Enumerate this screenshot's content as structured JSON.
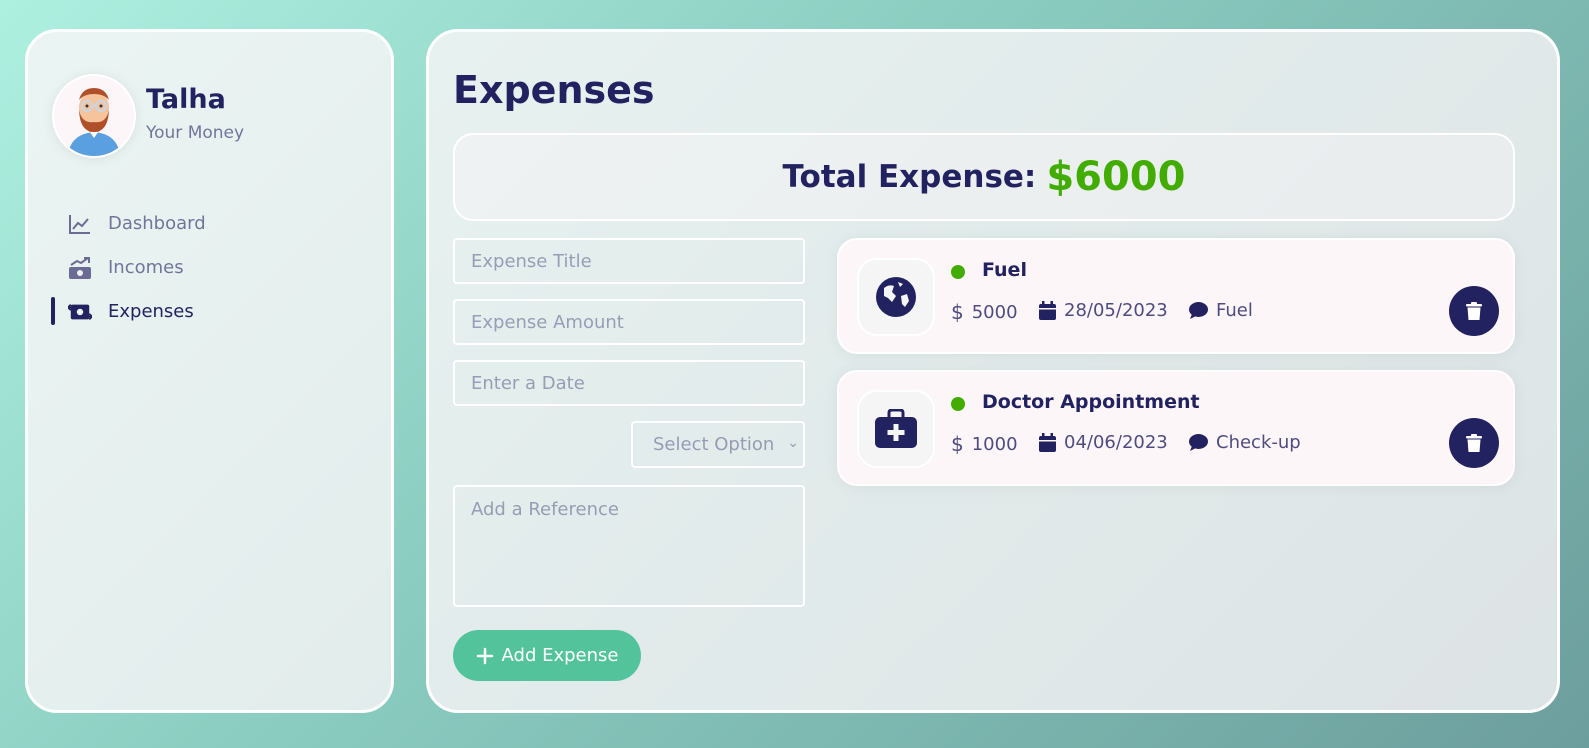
{
  "user": {
    "name": "Talha",
    "subtitle": "Your Money"
  },
  "nav": [
    {
      "label": "Dashboard",
      "icon": "chart-line-icon",
      "active": false
    },
    {
      "label": "Incomes",
      "icon": "money-bill-trend-icon",
      "active": false
    },
    {
      "label": "Expenses",
      "icon": "money-bill-transfer-icon",
      "active": true
    }
  ],
  "main": {
    "title": "Expenses",
    "total_label": "Total Expense:",
    "total_value": "$6000"
  },
  "form": {
    "title_placeholder": "Expense Title",
    "amount_placeholder": "Expense Amount",
    "date_placeholder": "Enter a Date",
    "category_selected": "Select Option",
    "reference_placeholder": "Add a Reference",
    "add_button": "Add Expense"
  },
  "expenses": [
    {
      "title": "Fuel",
      "amount": "5000",
      "date": "28/05/2023",
      "description": "Fuel",
      "icon": "globe-icon"
    },
    {
      "title": "Doctor Appointment",
      "amount": "1000",
      "date": "04/06/2023",
      "description": "Check-up",
      "icon": "medical-kit-icon"
    }
  ],
  "colors": {
    "accent": "#42ad00",
    "primary": "#222260",
    "button": "#53c39b"
  }
}
